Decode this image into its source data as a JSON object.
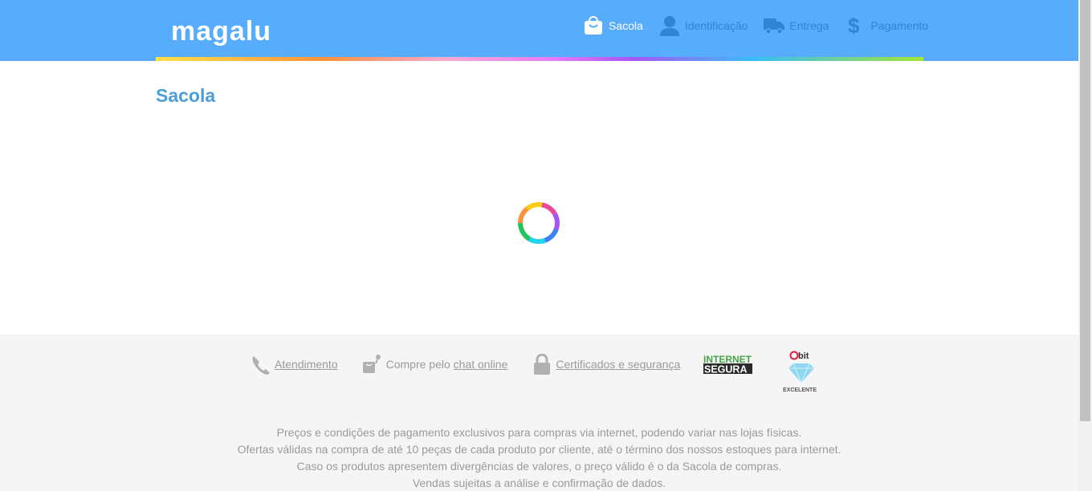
{
  "header": {
    "logo_text": "magalu",
    "steps": [
      {
        "label": "Sacola",
        "icon": "shopping-bag-icon",
        "active": true
      },
      {
        "label": "Identificação",
        "icon": "user-icon",
        "active": false
      },
      {
        "label": "Entrega",
        "icon": "truck-icon",
        "active": false
      },
      {
        "label": "Pagamento",
        "icon": "dollar-icon",
        "active": false
      }
    ]
  },
  "main": {
    "title": "Sacola",
    "loading": true
  },
  "footer": {
    "links": {
      "atendimento": "Atendimento",
      "chat_prefix": "Compre pelo",
      "chat_link": "chat online",
      "certificados": "Certificados e segurança"
    },
    "badges": {
      "internet_segura_line1": "INTERNET",
      "internet_segura_line2": "SEGURA",
      "ebit_brand": "bit",
      "ebit_rating": "EXCELENTE"
    },
    "notes": [
      "Preços e condições de pagamento exclusivos para compras via internet, podendo variar nas lojas físicas.",
      "Ofertas válidas na compra de até 10 peças de cada produto por cliente, até o término dos nossos estoques para internet.",
      "Caso os produtos apresentem divergências de valores, o preço válido é o da Sacola de compras.",
      "Vendas sujeitas a análise e confirmação de dados."
    ]
  },
  "colors": {
    "header_bg": "#58acfc",
    "title": "#4a9fd8",
    "inactive_step": "#2f84d4",
    "footer_text": "#9a9a9a"
  }
}
